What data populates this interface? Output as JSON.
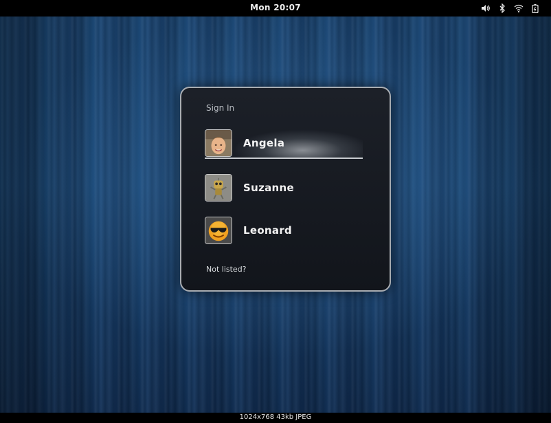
{
  "topbar": {
    "clock": "Mon 20:07",
    "icons": [
      "volume-icon",
      "bluetooth-icon",
      "wifi-icon",
      "battery-icon"
    ]
  },
  "dialog": {
    "title": "Sign In",
    "users": [
      {
        "name": "Angela",
        "avatar": "photo-avatar",
        "selected": true
      },
      {
        "name": "Suzanne",
        "avatar": "robot-avatar",
        "selected": false
      },
      {
        "name": "Leonard",
        "avatar": "smiley-sunglasses-avatar",
        "selected": false
      }
    ],
    "not_listed": "Not listed?"
  },
  "viewer": {
    "caption": "1024x768  43kb  JPEG"
  },
  "colors": {
    "wallpaper": "#1a4a7a",
    "dialog_bg": "#161a21",
    "dialog_border": "#a9adb2"
  }
}
